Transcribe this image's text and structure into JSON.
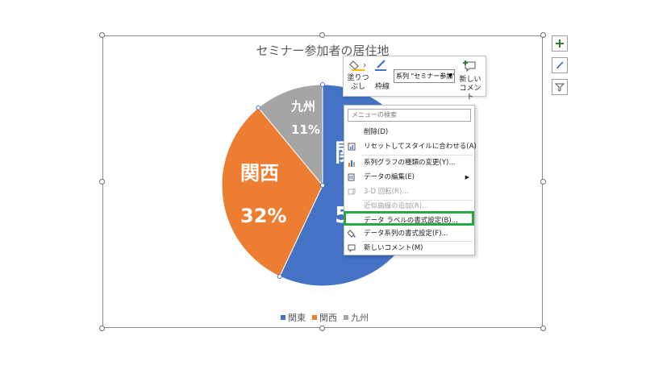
{
  "chart_title": "セミナー参加者の居住地",
  "chart_data": {
    "type": "pie",
    "title": "セミナー参加者の居住地",
    "categories": [
      "関東",
      "関西",
      "九州"
    ],
    "values": [
      57,
      32,
      11
    ],
    "colors": [
      "#4472C4",
      "#ED7D31",
      "#A5A5A5"
    ],
    "data_labels": [
      "57%",
      "32%",
      "11%"
    ],
    "legend_position": "bottom"
  },
  "slices": {
    "kanto": {
      "name": "関",
      "pct": "5"
    },
    "kansai": {
      "name": "関西",
      "pct": "32%"
    },
    "kyushu": {
      "name": "九州",
      "pct": "11%"
    }
  },
  "legend": [
    {
      "label": "関東",
      "color": "#4472C4"
    },
    {
      "label": "関西",
      "color": "#ED7D31"
    },
    {
      "label": "九州",
      "color": "#A5A5A5"
    }
  ],
  "side_buttons": {
    "elements": "plus-icon",
    "styles": "brush-icon",
    "filter": "filter-icon"
  },
  "mini_toolbar": {
    "fill_label_1": "塗りつ",
    "fill_label_2": "ぶし",
    "outline_label": "枠線",
    "series_select": "系列 \"セミナー参加\"",
    "new_comment_1": "新しい",
    "new_comment_2": "コメント"
  },
  "context_menu": {
    "search_placeholder": "メニューの検索",
    "items": [
      {
        "label": "削除(D)",
        "enabled": true
      },
      {
        "label": "リセットしてスタイルに合わせる(A)",
        "enabled": true
      },
      {
        "label": "系列グラフの種類の変更(Y)...",
        "enabled": true
      },
      {
        "label": "データの編集(E)",
        "enabled": true
      },
      {
        "label": "3-D 回転(R)...",
        "enabled": false
      },
      {
        "label": "近似曲線の追加(R)...",
        "enabled": false
      },
      {
        "label": "データ ラベルの書式設定(B)...",
        "enabled": true
      },
      {
        "label": "データ系列の書式設定(F)...",
        "enabled": true
      },
      {
        "label": "新しいコメント(M)",
        "enabled": true
      }
    ]
  },
  "colors": {
    "highlight": "#28a745",
    "accent_green": "#2e7d32"
  }
}
